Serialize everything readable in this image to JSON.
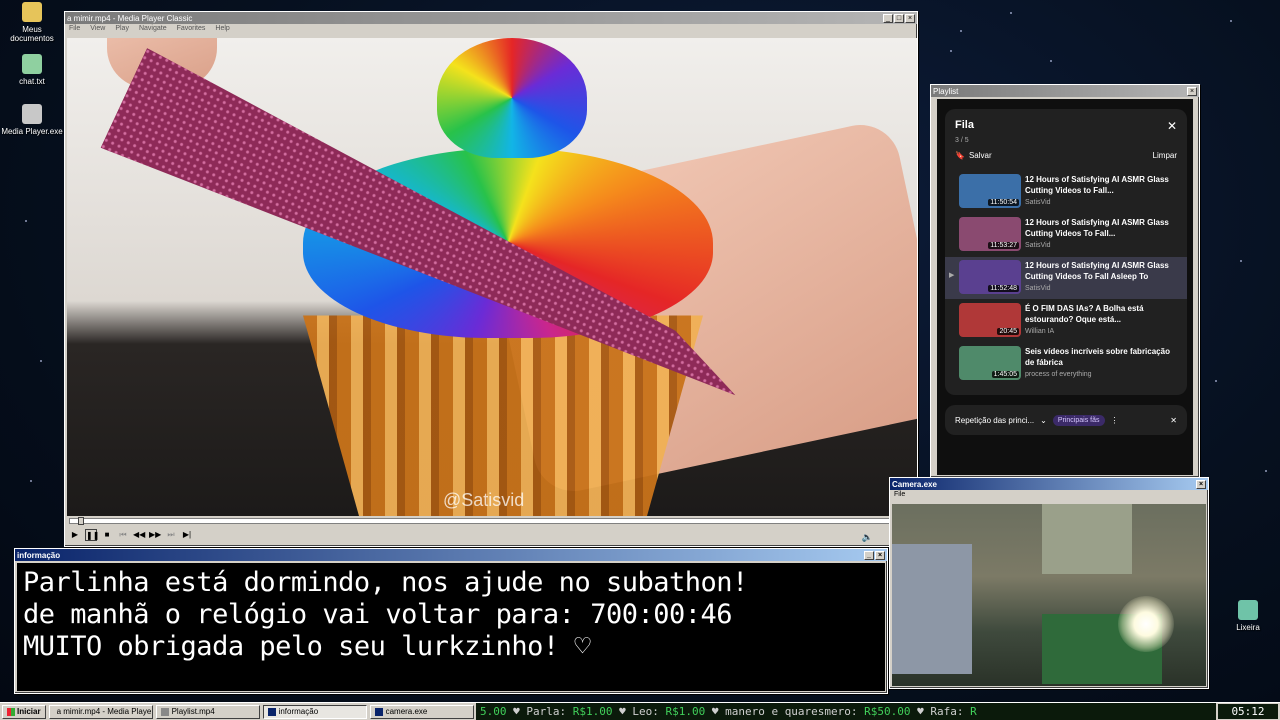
{
  "desktop": {
    "icons": [
      {
        "label": "Meus documentos",
        "icon": "folder-icon",
        "color": "#e6c45a"
      },
      {
        "label": "chat.txt",
        "icon": "notepad-icon",
        "color": "#8fd0a0"
      },
      {
        "label": "Media Player.exe",
        "icon": "media-player-icon",
        "color": "#c8c8c8"
      },
      {
        "label": "Lixeira",
        "icon": "recycle-bin-icon",
        "color": "#6fc3a8"
      }
    ]
  },
  "player": {
    "title": "a mimir.mp4 - Media Player Classic",
    "menu": [
      "File",
      "View",
      "Play",
      "Navigate",
      "Favorites",
      "Help"
    ],
    "watermark": "@Satisvid",
    "progress": 0.01
  },
  "playlist": {
    "window_title": "Playlist",
    "heading": "Fila",
    "count": "3 / 5",
    "save_label": "Salvar",
    "clear_label": "Limpar",
    "items": [
      {
        "title": "12 Hours of Satisfying AI ASMR Glass Cutting Videos to Fall...",
        "channel": "SatisVid",
        "duration": "11:50:54",
        "thumb": "#3b6fa8"
      },
      {
        "title": "12 Hours of Satisfying AI ASMR Glass Cutting Videos To Fall...",
        "channel": "SatisVid",
        "duration": "11:53:27",
        "thumb": "#8a4a70"
      },
      {
        "title": "12 Hours of Satisfying AI ASMR Glass Cutting Videos To Fall Asleep To",
        "channel": "SatisVid",
        "duration": "11:52:48",
        "thumb": "#5a4090"
      },
      {
        "title": "É O FIM DAS IAs? A Bolha está estourando? Oque está...",
        "channel": "Willian IA",
        "duration": "20:45",
        "thumb": "#b03838"
      },
      {
        "title": "Seis vídeos incríveis sobre fabricação de fábrica",
        "channel": "process of everything",
        "duration": "1:45:05",
        "thumb": "#4f8a6a"
      }
    ],
    "loop_label": "Repetição das princi...",
    "loop_badge": "Principais fãs"
  },
  "info": {
    "window_title": "informação",
    "lines": [
      "Parlinha está dormindo, nos ajude no subathon!",
      "de manhã o relógio vai voltar para:  700:00:46",
      "MUITO obrigada pelo seu lurkzinho! ♡"
    ]
  },
  "camera": {
    "window_title": "Camera.exe",
    "menu_file": "File"
  },
  "taskbar": {
    "start_label": "Iniciar",
    "tasks": [
      "a mimir.mp4 - Media Playe...",
      "Playlist.mp4",
      "informação",
      "camera.exe"
    ],
    "ticker_parts": [
      {
        "t": "5.00 ",
        "c": "g"
      },
      {
        "t": "♥  Parla: ",
        "c": ""
      },
      {
        "t": "R$1.00",
        "c": "g"
      },
      {
        "t": "  ♥  Leo: ",
        "c": ""
      },
      {
        "t": "R$1.00",
        "c": "g"
      },
      {
        "t": "  ♥  manero e quaresmero: ",
        "c": ""
      },
      {
        "t": "R$50.00",
        "c": "g"
      },
      {
        "t": "  ♥  Rafa: ",
        "c": ""
      },
      {
        "t": "R",
        "c": "g"
      }
    ],
    "clock": "05:12"
  }
}
